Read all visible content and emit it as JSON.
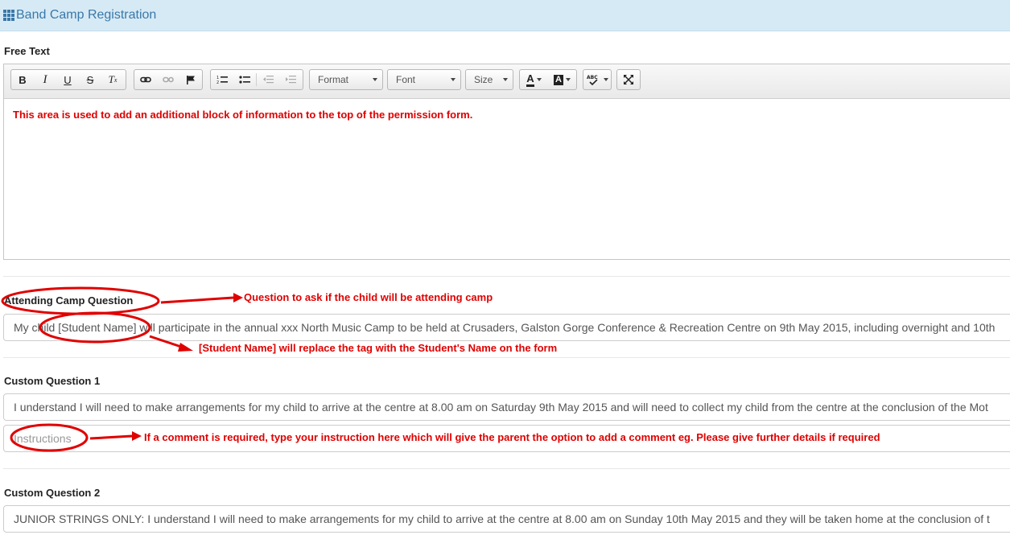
{
  "header": {
    "title": "Band Camp Registration",
    "icon": "grid-icon"
  },
  "free_text": {
    "label": "Free Text",
    "toolbar": {
      "format_label": "Format",
      "font_label": "Font",
      "size_label": "Size"
    },
    "content": "This area is used to add an additional block of information to the top of the permission form."
  },
  "attending": {
    "label": "Attending Camp Question",
    "value": "My child [Student Name] will participate in the annual xxx North Music Camp to be held at Crusaders, Galston Gorge Conference & Recreation Centre on 9th May 2015, including overnight and 10th"
  },
  "custom1": {
    "label": "Custom Question 1",
    "value": "I understand I will need to make arrangements for my child to arrive at the centre at 8.00 am on Saturday 9th May 2015 and will need to collect my child from the centre at the conclusion of the Mot",
    "instructions_placeholder": "Instructions"
  },
  "custom2": {
    "label": "Custom Question 2",
    "value": "JUNIOR STRINGS ONLY: I understand I will need to make arrangements for my child to arrive at the centre at 8.00 am on Sunday 10th May 2015 and they will be taken home at the conclusion of t"
  },
  "annotations": {
    "attending_note": "Question to ask if the child will be attending camp",
    "tag_note": "[Student Name] will replace the tag with the Student's Name on the form",
    "instructions_note": "If a comment is required, type your instruction here which will give the parent the option to add a comment eg. Please give further details if required",
    "color": "#e00000"
  }
}
